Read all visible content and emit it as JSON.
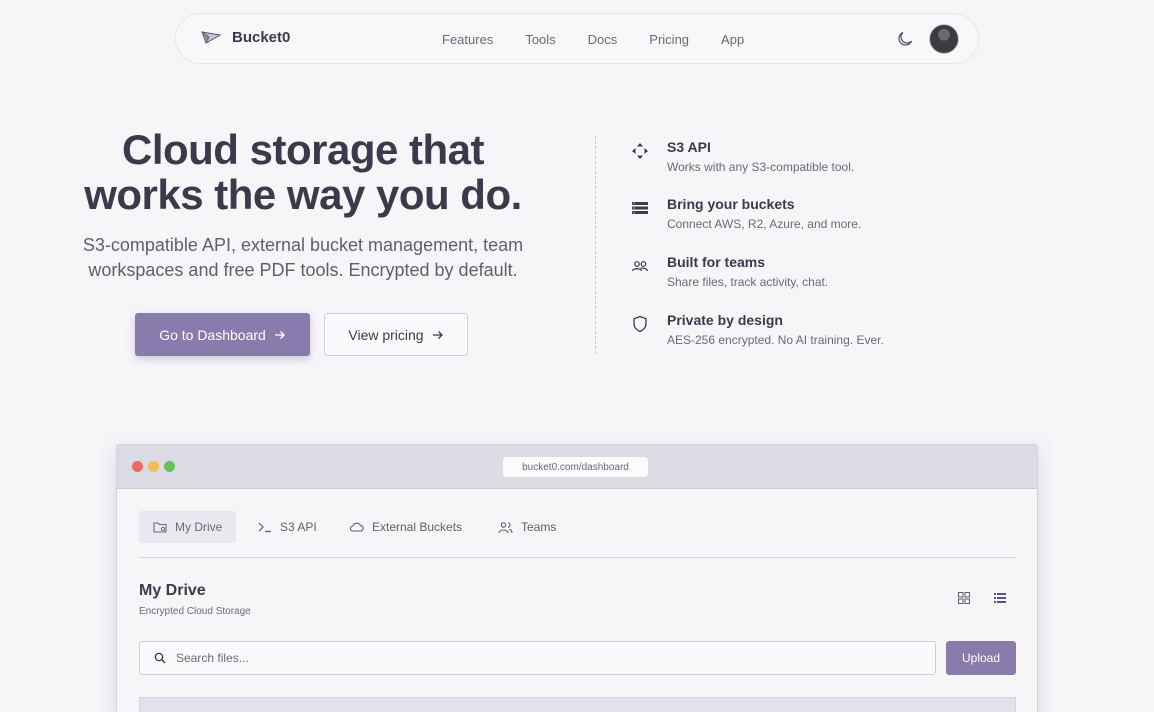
{
  "nav": {
    "brand": "Bucket0",
    "links": [
      "Features",
      "Tools",
      "Docs",
      "Pricing",
      "App"
    ],
    "icons": {
      "logo": "paper-plane-logo",
      "theme": "moon-icon",
      "avatar": "user-avatar"
    }
  },
  "hero": {
    "title": "Cloud storage that works the way you do.",
    "subtitle": "S3-compatible API, external bucket management, team workspaces and free PDF tools. Encrypted by default.",
    "primary_button": "Go to Dashboard",
    "secondary_button": "View pricing"
  },
  "features": [
    {
      "icon": "move-arrows-icon",
      "title": "S3 API",
      "desc": "Works with any S3-compatible tool."
    },
    {
      "icon": "server-stack-icon",
      "title": "Bring your buckets",
      "desc": "Connect AWS, R2, Azure, and more."
    },
    {
      "icon": "users-icon",
      "title": "Built for teams",
      "desc": "Share files, track activity, chat."
    },
    {
      "icon": "shield-icon",
      "title": "Private by design",
      "desc": "AES-256 encrypted. No AI training. Ever."
    }
  ],
  "mock": {
    "url": "bucket0.com/dashboard",
    "tabs": [
      "My Drive",
      "S3 API",
      "External Buckets",
      "Teams"
    ],
    "active_tab": "My Drive",
    "drive_title": "My Drive",
    "drive_subtitle": "Encrypted Cloud Storage",
    "search_placeholder": "Search files...",
    "upload_label": "Upload"
  },
  "colors": {
    "accent": "#8a7bad",
    "background": "#f6f6f9",
    "text": "#3b3a4a",
    "traffic_red": "#ec6a5e",
    "traffic_yellow": "#f4bf4f",
    "traffic_green": "#61c554"
  }
}
